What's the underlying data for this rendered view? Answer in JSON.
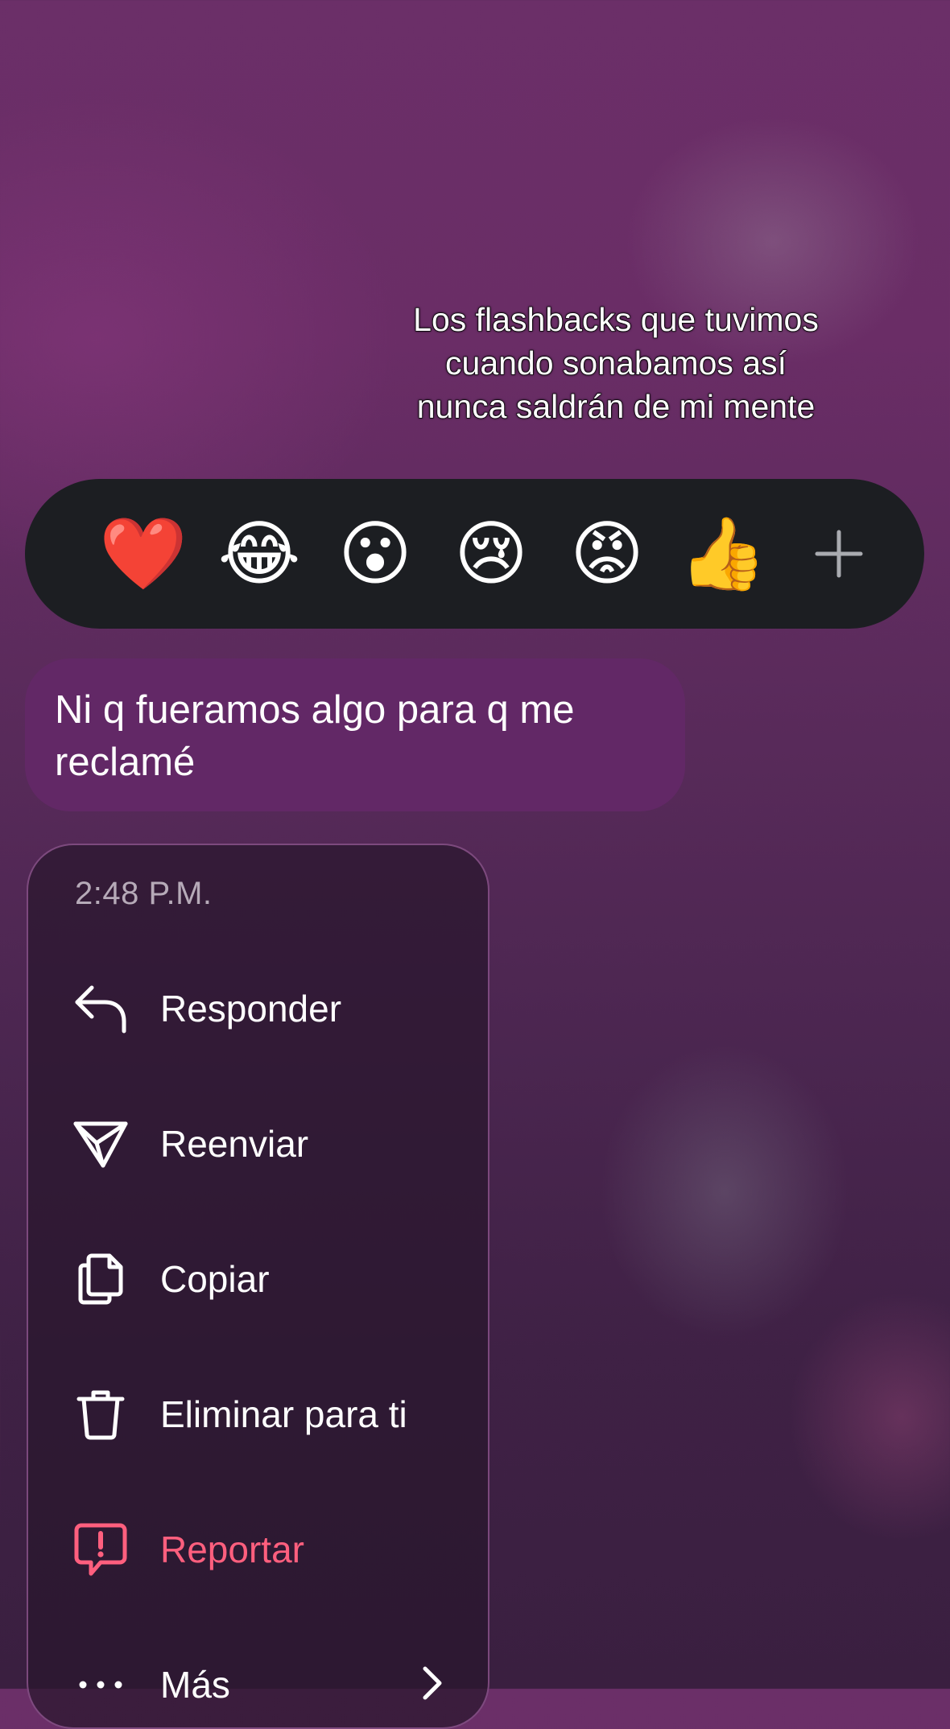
{
  "caption": {
    "text": "Los flashbacks que tuvimos cuando sonabamos así nunca saldrán de mi mente"
  },
  "reactions": [
    {
      "emoji": "❤️",
      "icon": "heart-emoji"
    },
    {
      "emoji": "😂",
      "icon": "tears-of-joy-emoji"
    },
    {
      "emoji": "😮",
      "icon": "surprised-emoji"
    },
    {
      "emoji": "😢",
      "icon": "crying-emoji"
    },
    {
      "emoji": "😡",
      "icon": "angry-emoji"
    },
    {
      "emoji": "👍",
      "icon": "thumbs-up-emoji"
    }
  ],
  "add_reaction_icon": "plus-icon",
  "message": {
    "text": "Ni q fueramos algo para q me reclamé",
    "bubble_color": "#622866"
  },
  "menu": {
    "time": "2:48 P.M.",
    "items": [
      {
        "label": "Responder",
        "icon": "reply-icon"
      },
      {
        "label": "Reenviar",
        "icon": "forward-icon"
      },
      {
        "label": "Copiar",
        "icon": "copy-icon"
      },
      {
        "label": "Eliminar para ti",
        "icon": "trash-icon"
      },
      {
        "label": "Reportar",
        "icon": "report-icon",
        "color": "#ff5f7e"
      },
      {
        "label": "Más",
        "icon": "more-icon"
      }
    ]
  }
}
